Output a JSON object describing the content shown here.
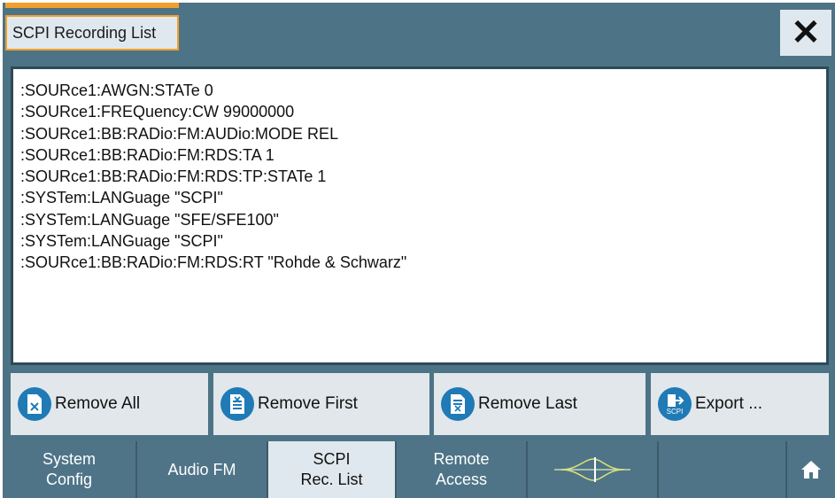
{
  "window": {
    "title": "SCPI Recording List",
    "close_icon": "close-icon"
  },
  "commands": [
    ":SOURce1:AWGN:STATe 0",
    ":SOURce1:FREQuency:CW 99000000",
    ":SOURce1:BB:RADio:FM:AUDio:MODE REL",
    ":SOURce1:BB:RADio:FM:RDS:TA 1",
    ":SOURce1:BB:RADio:FM:RDS:TP:STATe 1",
    ":SYSTem:LANGuage \"SCPI\"",
    ":SYSTem:LANGuage \"SFE/SFE100\"",
    ":SYSTem:LANGuage \"SCPI\"",
    ":SOURce1:BB:RADio:FM:RDS:RT \"Rohde & Schwarz\""
  ],
  "actions": {
    "remove_all": "Remove All",
    "remove_first": "Remove First",
    "remove_last": "Remove Last",
    "export": "Export ...",
    "export_icon_text": "SCPI"
  },
  "taskbar": {
    "system_config": [
      "System",
      "Config"
    ],
    "audio_fm": "Audio FM",
    "scpi_rec_list": [
      "SCPI",
      "Rec. List"
    ],
    "remote_access": [
      "Remote",
      "Access"
    ],
    "active_tab": "SCPI Rec. List",
    "waveform_icon": "waveform-icon",
    "home_icon": "home-icon"
  },
  "colors": {
    "frame": "#4d7386",
    "accent": "#f2a02c",
    "button": "#e1e7eb",
    "icon_blue": "#1f7ab6",
    "active_tab": "#dfe8ee"
  }
}
